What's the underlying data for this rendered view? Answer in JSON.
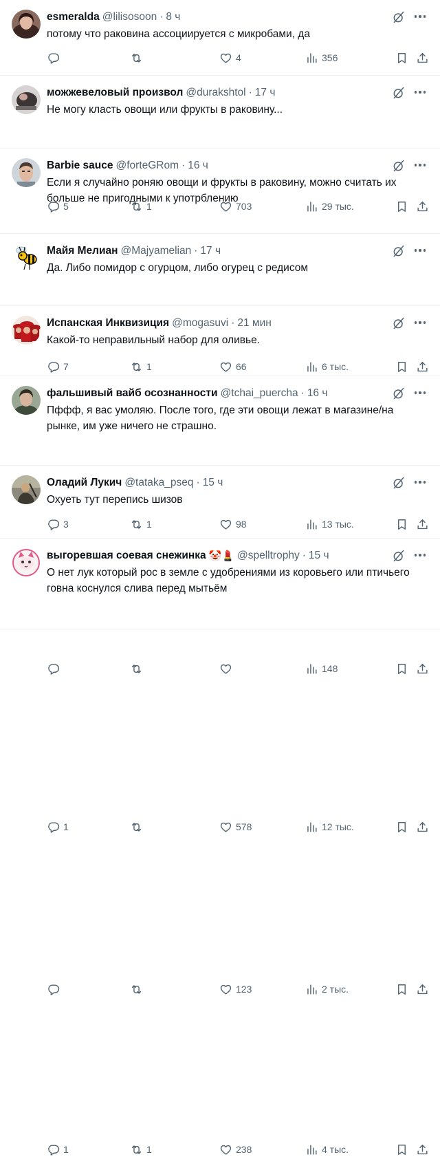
{
  "tweets": [
    {
      "name": "esmeralda",
      "handle": "@lilisosoon",
      "time": "8 ч",
      "emoji": "",
      "text": "потому что раковина ассоциируется с микробами, да",
      "replies": "",
      "reposts": "",
      "likes": "4",
      "views": "356",
      "avatar": "woman-dark-hair-avatar"
    },
    {
      "name": "можжевеловый произвол",
      "handle": "@durakshtol",
      "time": "17 ч",
      "emoji": "",
      "text": "Не могу класть овощи или фрукты в раковину...",
      "replies": "5",
      "reposts": "1",
      "likes": "703",
      "views": "29 тыс.",
      "avatar": "dark-figure-avatar"
    },
    {
      "name": "Barbie sauce",
      "handle": "@forteGRom",
      "time": "16 ч",
      "emoji": "",
      "text": "Если я случайно роняю овощи и фрукты в раковину, можно считать их больше не пригодными к употрблению",
      "replies": "7",
      "reposts": "1",
      "likes": "66",
      "views": "6 тыс.",
      "avatar": "man-face-avatar"
    },
    {
      "name": "Майя Мелиан",
      "handle": "@Majyamelian",
      "time": "17 ч",
      "emoji": "",
      "text": "Да. Либо помидор с огурцом, либо огурец с редисом",
      "replies": "3",
      "reposts": "1",
      "likes": "98",
      "views": "13 тыс.",
      "avatar": "bee-avatar"
    },
    {
      "name": "Испанская Инквизиция",
      "handle": "@mogasuvi",
      "time": "21 мин",
      "emoji": "",
      "text": "Какой-то неправильный набор для оливье.",
      "replies": "",
      "reposts": "",
      "likes": "",
      "views": "148",
      "avatar": "cardinals-avatar"
    },
    {
      "name": "фальшивый вайб осознанности",
      "handle": "@tchai_puercha",
      "time": "16 ч",
      "emoji": "",
      "text": "Пффф, я вас умоляю. После того, где эти овощи лежат в магазине/на рынке, им уже ничего не страшно.",
      "replies": "1",
      "reposts": "",
      "likes": "578",
      "views": "12 тыс.",
      "avatar": "man-green-avatar"
    },
    {
      "name": "Оладий Лукич",
      "handle": "@tataka_pseq",
      "time": "15 ч",
      "emoji": "",
      "text": "Охуеть тут перепись шизов",
      "replies": "",
      "reposts": "",
      "likes": "123",
      "views": "2 тыс.",
      "avatar": "painting-avatar"
    },
    {
      "name": "выгоревшая соевая снежинка",
      "handle": "@spelltrophy",
      "time": "15 ч",
      "emoji": "🤡💄",
      "text": "О нет лук который рос в земле с удобрениями из коровьего или птичьего говна коснулся слива перед мытьём",
      "replies": "1",
      "reposts": "1",
      "likes": "238",
      "views": "4 тыс.",
      "avatar": "cat-avatar"
    }
  ],
  "colors": {
    "text": "#0f1419",
    "secondary": "#536471",
    "divider": "#eff3f4"
  }
}
